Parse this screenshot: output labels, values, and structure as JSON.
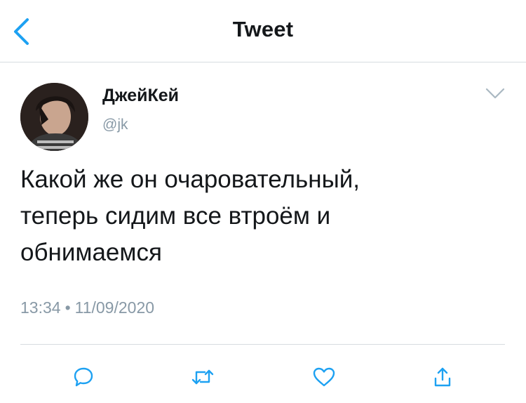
{
  "nav": {
    "title": "Tweet",
    "back_icon": "chevron-left-icon",
    "accent": "#1da1f2"
  },
  "tweet": {
    "author": {
      "display_name": "ДжейКей",
      "handle": "@jk"
    },
    "text_lines": [
      "Какой же он очаровательный,",
      "теперь сидим все втроём и",
      "обнимаемся"
    ],
    "time": "13:34",
    "separator": "•",
    "date": "11/09/2020"
  },
  "actions": [
    {
      "icon": "reply-icon"
    },
    {
      "icon": "retweet-icon"
    },
    {
      "icon": "like-icon"
    },
    {
      "icon": "share-icon"
    }
  ],
  "colors": {
    "text": "#14171a",
    "secondary": "#8899a6",
    "divider": "#d7dce0"
  }
}
